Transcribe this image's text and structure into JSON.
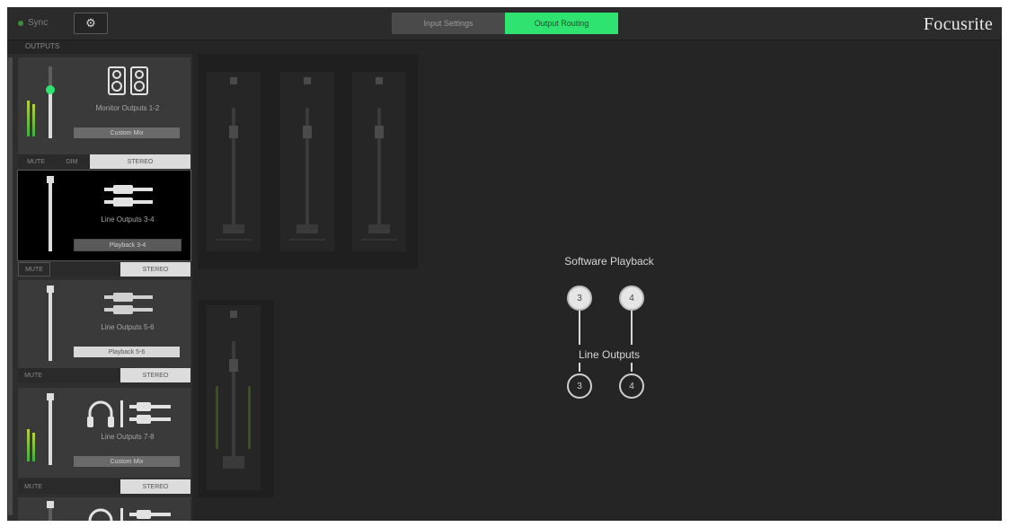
{
  "topbar": {
    "sync_label": "Sync",
    "tabs": [
      {
        "label": "Input Settings",
        "active": false
      },
      {
        "label": "Output Routing",
        "active": true
      }
    ],
    "brand": "Focusrite"
  },
  "sidebar": {
    "title": "OUTPUTS",
    "cards": [
      {
        "name": "Monitor Outputs 1-2",
        "source": "Custom Mix",
        "buttons": [
          "MUTE",
          "DIM",
          "STEREO"
        ]
      },
      {
        "name": "Line Outputs 3-4",
        "source": "Playback 3-4",
        "buttons": [
          "MUTE",
          "STEREO"
        ]
      },
      {
        "name": "Line Outputs 5-6",
        "source": "Playback 5-6",
        "buttons": [
          "MUTE",
          "STEREO"
        ]
      },
      {
        "name": "Line Outputs 7-8",
        "source": "Custom Mix",
        "buttons": [
          "MUTE",
          "STEREO"
        ]
      }
    ]
  },
  "routing": {
    "title": "Software Playback",
    "mid_label": "Line Outputs",
    "sources": [
      "3",
      "4"
    ],
    "destinations": [
      "3",
      "4"
    ]
  },
  "colors": {
    "accent": "#2ee36f",
    "background": "#252525",
    "sidebar_card": "#3a3a3a"
  }
}
